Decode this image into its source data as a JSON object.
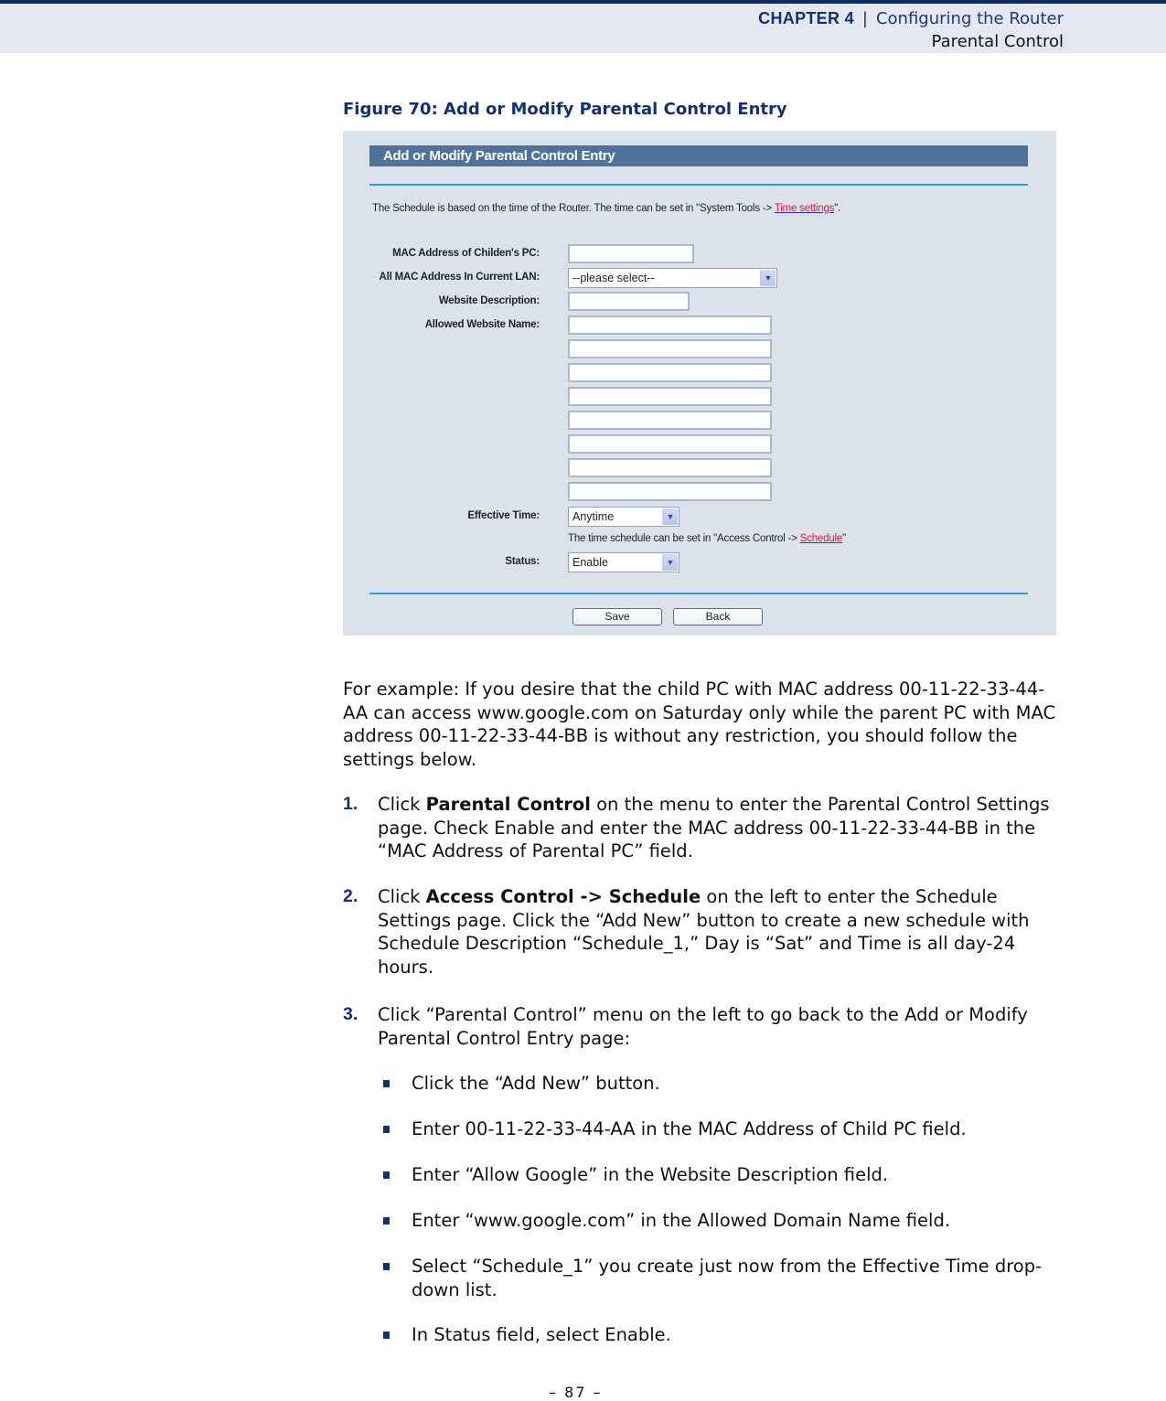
{
  "header": {
    "chapter_label": "CHAPTER 4",
    "separator": "|",
    "chapter_title": "Configuring the Router",
    "section": "Parental Control"
  },
  "figure": {
    "caption": "Figure 70:  Add or Modify Parental Control Entry"
  },
  "panel": {
    "title": "Add or Modify Parental Control Entry",
    "note_prefix": "The Schedule is based on the time of the Router. The time can be set in \"System Tools -> ",
    "note_link": "Time settings",
    "note_suffix": "\".",
    "fields": {
      "mac_child_label": "MAC Address of Childen's PC:",
      "mac_child_value": "",
      "all_mac_label": "All MAC Address In Current LAN:",
      "all_mac_value": "--please select--",
      "website_desc_label": "Website Description:",
      "website_desc_value": "",
      "allowed_site_label": "Allowed Website Name:",
      "allowed_sites": [
        "",
        "",
        "",
        "",
        "",
        "",
        "",
        ""
      ],
      "effective_time_label": "Effective Time:",
      "effective_time_value": "Anytime",
      "schedule_note_prefix": "The time schedule can be set in \"Access Control -> ",
      "schedule_note_link": "Schedule",
      "schedule_note_suffix": "\"",
      "status_label": "Status:",
      "status_value": "Enable"
    },
    "buttons": {
      "save": "Save",
      "back": "Back"
    },
    "colors": {
      "title_bar": "#4e7299",
      "background": "#dce2ec",
      "divider": "#2a9ad6",
      "link": "#e8102e"
    }
  },
  "body": {
    "intro": "For example: If you desire that the child PC with MAC address 00-11-22-33-44-AA can access www.google.com on Saturday only while the parent PC with MAC address 00-11-22-33-44-BB is without any restriction, you should follow the settings below.",
    "steps": [
      {
        "num": "1.",
        "pre": "Click ",
        "bold": "Parental Control",
        "post": " on the menu to enter the Parental Control Settings page. Check Enable and enter the MAC address 00-11-22-33-44-BB in the “MAC Address of Parental PC” field."
      },
      {
        "num": "2.",
        "pre": "Click ",
        "bold": "Access Control -> Schedule",
        "post": " on the left to enter the Schedule Settings page. Click the “Add New” button to create a new schedule with Schedule Description “Schedule_1,” Day is “Sat” and Time is all day-24 hours."
      },
      {
        "num": "3.",
        "pre": "Click “Parental Control” menu on the left to go back to the Add or Modify Parental Control Entry page:",
        "bold": "",
        "post": ""
      }
    ],
    "bullets": [
      "Click the “Add New” button.",
      "Enter 00-11-22-33-44-AA in the MAC Address of Child PC field.",
      "Enter “Allow Google” in the Website Description field.",
      "Enter “www.google.com” in the Allowed Domain Name field.",
      "Select “Schedule_1” you create just now from the Effective Time drop-down list.",
      "In Status field, select Enable."
    ]
  },
  "footer": {
    "page_number": "–  87  –"
  }
}
